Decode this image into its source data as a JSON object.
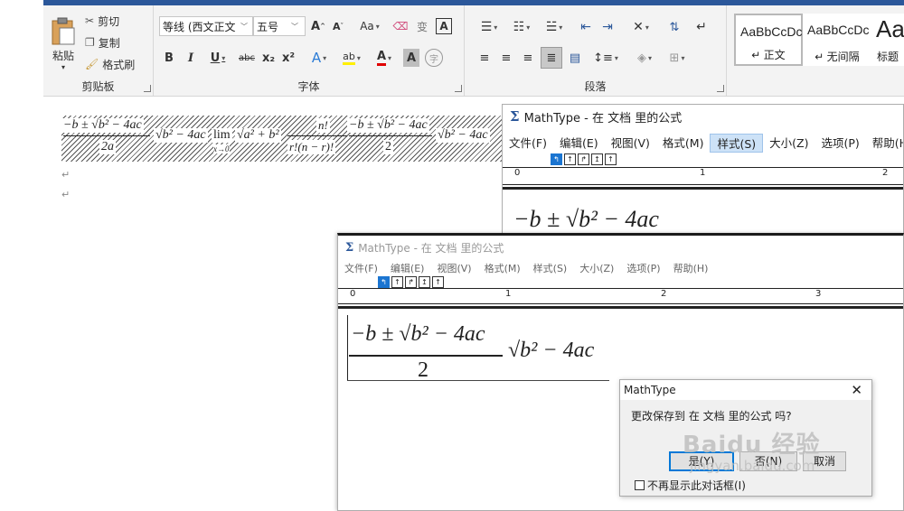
{
  "ribbon": {
    "clipboard": {
      "paste_label": "粘贴",
      "cut_label": "剪切",
      "copy_label": "复制",
      "format_painter_label": "格式刷",
      "group_name": "剪贴板"
    },
    "font": {
      "font_name": "等线 (西文正文",
      "font_size": "五号",
      "grow_label": "A",
      "shrink_label": "A",
      "case_label": "Aa",
      "phonetic_label": "变",
      "border_char_label": "A",
      "bold_label": "B",
      "italic_label": "I",
      "underline_label": "U",
      "strike_label": "abc",
      "subscript_label": "x₂",
      "superscript_label": "x²",
      "effects_label": "A",
      "highlight_label": "ab",
      "color_label": "A",
      "shade_label": "A",
      "enclose_label": "字",
      "group_name": "字体"
    },
    "paragraph": {
      "group_name": "段落"
    },
    "styles": {
      "items": [
        {
          "sample": "AaBbCcDc",
          "name": "↵ 正文"
        },
        {
          "sample": "AaBbCcDc",
          "name": "↵ 无间隔"
        },
        {
          "sample": "Aa",
          "name": "标题"
        }
      ]
    }
  },
  "document": {
    "formula_pieces": {
      "quadratic_num": "−b ± √b² − 4ac",
      "quadratic_den": "2a",
      "sqrt_expr": "√b² − 4ac",
      "lim_expr": "lim",
      "lim_sub": "x→0",
      "sqrt_sum": "√a² + b²",
      "comb_num": "n!",
      "comb_den": "r!(n − r)!",
      "quadratic2_num": "−b ± √b² − 4ac",
      "quadratic2_den": "2",
      "sqrt_expr2": "√b² − 4ac"
    },
    "para_mark": "↵"
  },
  "mathtype_back": {
    "title": "MathType - 在 文档 里的公式",
    "menu": [
      "文件(F)",
      "编辑(E)",
      "视图(V)",
      "格式(M)",
      "样式(S)",
      "大小(Z)",
      "选项(P)",
      "帮助(H)"
    ],
    "highlighted_menu": "样式(S)",
    "ruler_numbers": [
      "0",
      "1",
      "2"
    ],
    "equation": {
      "num": "−b ± √b² − 4ac"
    }
  },
  "mathtype_front": {
    "title": "MathType - 在 文档 里的公式",
    "menu": [
      "文件(F)",
      "编辑(E)",
      "视图(V)",
      "格式(M)",
      "样式(S)",
      "大小(Z)",
      "选项(P)",
      "帮助(H)"
    ],
    "ruler_numbers": [
      "0",
      "1",
      "2",
      "3"
    ],
    "equation": {
      "num": "−b ± √b² − 4ac",
      "den": "2",
      "sqrt": "√b² − 4ac"
    }
  },
  "dialog": {
    "title": "MathType",
    "message": "更改保存到 在 文档 里的公式 吗?",
    "yes_label": "是(Y)",
    "no_label": "否(N)",
    "cancel_label": "取消",
    "checkbox_label": "不再显示此对话框(I)"
  },
  "watermark": {
    "text_big": "Baidu 经验",
    "text_small": "jingyan.baidu.com"
  }
}
